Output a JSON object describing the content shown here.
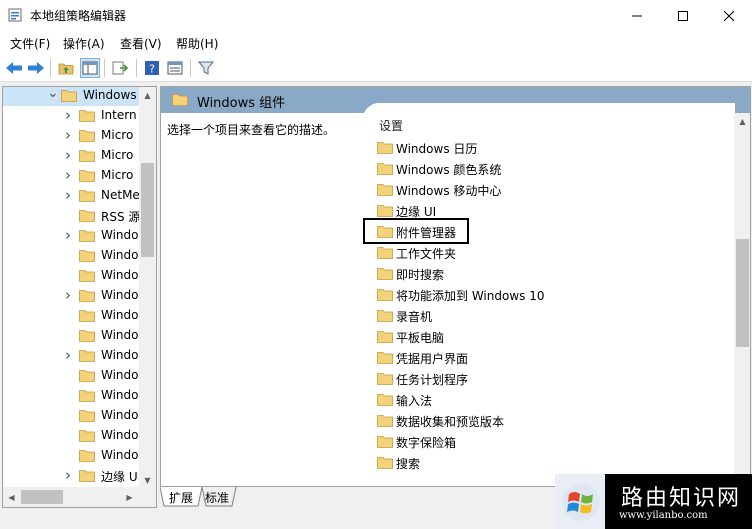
{
  "window": {
    "title": "本地组策略编辑器"
  },
  "menu": {
    "file": "文件(F)",
    "action": "操作(A)",
    "view": "查看(V)",
    "help": "帮助(H)"
  },
  "tree": {
    "items": [
      {
        "label": "Windows",
        "expander": "open",
        "selected": true
      },
      {
        "label": "Intern",
        "expander": "closed"
      },
      {
        "label": "Micro",
        "expander": "closed"
      },
      {
        "label": "Micro",
        "expander": "closed"
      },
      {
        "label": "Micro",
        "expander": "closed"
      },
      {
        "label": "NetMe",
        "expander": "closed"
      },
      {
        "label": "RSS 源",
        "expander": "none"
      },
      {
        "label": "Windo",
        "expander": "closed"
      },
      {
        "label": "Windo",
        "expander": "none"
      },
      {
        "label": "Windo",
        "expander": "none"
      },
      {
        "label": "Windo",
        "expander": "closed"
      },
      {
        "label": "Windo",
        "expander": "none"
      },
      {
        "label": "Windo",
        "expander": "none"
      },
      {
        "label": "Windo",
        "expander": "closed"
      },
      {
        "label": "Windo",
        "expander": "none"
      },
      {
        "label": "Windo",
        "expander": "none"
      },
      {
        "label": "Windo",
        "expander": "none"
      },
      {
        "label": "Windo",
        "expander": "none"
      },
      {
        "label": "Windo",
        "expander": "none"
      },
      {
        "label": "边缘 U",
        "expander": "closed"
      }
    ]
  },
  "right": {
    "header_title": "Windows 组件",
    "description": "选择一个项目来查看它的描述。",
    "column_header": "设置",
    "items": [
      "Windows 日历",
      "Windows 颜色系统",
      "Windows 移动中心",
      "边缘 UI",
      "附件管理器",
      "工作文件夹",
      "即时搜索",
      "将功能添加到 Windows 10",
      "录音机",
      "平板电脑",
      "凭据用户界面",
      "任务计划程序",
      "输入法",
      "数据收集和预览版本",
      "数字保险箱",
      "搜索"
    ]
  },
  "tabs": {
    "extended": "扩展",
    "standard": "标准"
  },
  "watermark": {
    "title": "路由知识网",
    "url": "www.yilanbo.com"
  },
  "colors": {
    "header_bg": "#8aa9c7",
    "selection": "#cce4f7",
    "folder": "#e8c36a"
  }
}
